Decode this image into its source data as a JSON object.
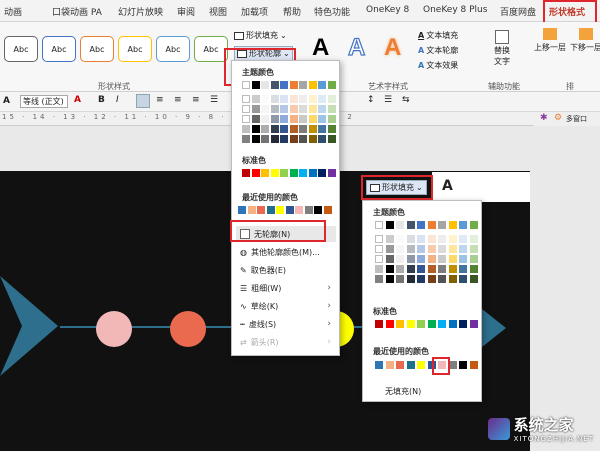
{
  "tabs": [
    "动画",
    "口袋动画 PA",
    "幻灯片放映",
    "审阅",
    "视图",
    "加载项",
    "帮助",
    "特色功能",
    "OneKey 8",
    "OneKey 8 Plus",
    "百度网盘",
    "形状格式"
  ],
  "ribbon": {
    "style_boxes": [
      "Abc",
      "Abc",
      "Abc",
      "Abc",
      "Abc",
      "Abc"
    ],
    "shape_styles_label": "形状样式",
    "fill_label": "形状填充",
    "outline_label": "形状轮廓",
    "art_label": "艺术字样式",
    "text_fill": "文本填充",
    "text_outline": "文本轮廓",
    "text_effects": "文本效果",
    "alt_text": "替换\n文字",
    "assist_label": "辅助功能",
    "bring_forward": "上移一层",
    "send_backward": "下移一层",
    "arrange_label": "排",
    "font_name": "等线 (正文)",
    "font_size": "A"
  },
  "right_panel": {
    "multi_window": "多窗口"
  },
  "outline_menu": {
    "theme_title": "主题颜色",
    "standard_title": "标准色",
    "recent_title": "最近使用的颜色",
    "items": [
      {
        "label": "无轮廓(N)",
        "icon": "no-outline-icon"
      },
      {
        "label": "其他轮廓颜色(M)...",
        "icon": "palette-icon"
      },
      {
        "label": "取色器(E)",
        "icon": "eyedropper-icon"
      },
      {
        "label": "粗细(W)",
        "icon": "weight-icon"
      },
      {
        "label": "草绘(K)",
        "icon": "sketch-icon"
      },
      {
        "label": "虚线(S)",
        "icon": "dash-icon"
      },
      {
        "label": "箭头(R)",
        "icon": "arrow-icon"
      }
    ]
  },
  "fill_menu": {
    "header": "形状填充",
    "theme_title": "主题颜色",
    "standard_title": "标准色",
    "recent_title": "最近使用的颜色",
    "no_fill": "无填充(N)"
  },
  "colors": {
    "theme_top": [
      "#ffffff",
      "#000000",
      "#e7e6e6",
      "#44546a",
      "#4472c4",
      "#ed7d31",
      "#a5a5a5",
      "#ffc000",
      "#5b9bd5",
      "#70ad47"
    ],
    "standard": [
      "#c00000",
      "#ff0000",
      "#ffc000",
      "#ffff00",
      "#92d050",
      "#00b050",
      "#00b0f0",
      "#0070c0",
      "#002060",
      "#7030a0"
    ],
    "recent": [
      "#2e75b6",
      "#f4b183",
      "#e96a4f",
      "#1f6e8c",
      "#ffff00",
      "#2f5597",
      "#f2b8b8",
      "#7f7f7f",
      "#000000",
      "#c55a11"
    ],
    "accent": "#e0262d",
    "active_tab": "#c0392b"
  },
  "watermark": {
    "brand": "系统之家",
    "url": "XITONGZHIJIA.NET"
  }
}
